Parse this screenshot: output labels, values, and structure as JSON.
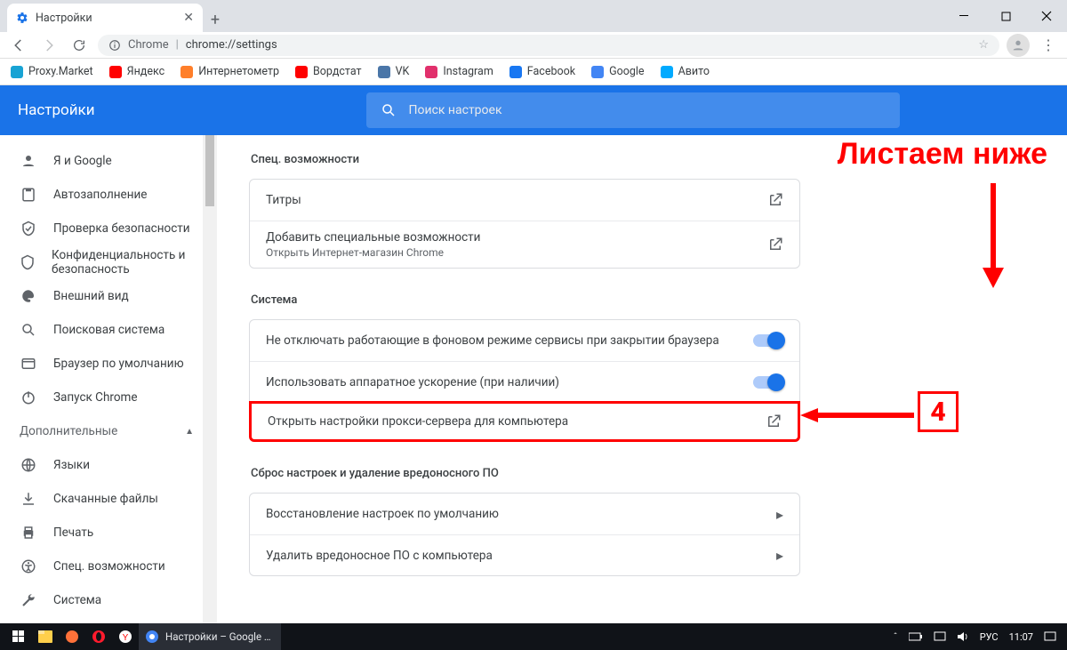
{
  "window": {
    "tab_title": "Настройки",
    "url_prefix": "Chrome",
    "url_rest": "chrome://settings"
  },
  "bookmarks": [
    {
      "label": "Proxy.Market",
      "color": "#18a3d4"
    },
    {
      "label": "Яндекс",
      "color": "#ff0000"
    },
    {
      "label": "Интернетометр",
      "color": "#ff7f2a"
    },
    {
      "label": "Вордстат",
      "color": "#ff0000"
    },
    {
      "label": "VK",
      "color": "#4a76a8"
    },
    {
      "label": "Instagram",
      "color": "#e1306c"
    },
    {
      "label": "Facebook",
      "color": "#1877f2"
    },
    {
      "label": "Google",
      "color": "#4285f4"
    },
    {
      "label": "Авито",
      "color": "#00aaff"
    }
  ],
  "header": {
    "title": "Настройки",
    "search_placeholder": "Поиск настроек"
  },
  "sidebar": {
    "items": [
      {
        "label": "Я и Google",
        "icon": "person"
      },
      {
        "label": "Автозаполнение",
        "icon": "autofill"
      },
      {
        "label": "Проверка безопасности",
        "icon": "safety"
      },
      {
        "label": "Конфиденциальность и безопасность",
        "icon": "shield"
      },
      {
        "label": "Внешний вид",
        "icon": "palette"
      },
      {
        "label": "Поисковая система",
        "icon": "search"
      },
      {
        "label": "Браузер по умолчанию",
        "icon": "browser"
      },
      {
        "label": "Запуск Chrome",
        "icon": "power"
      }
    ],
    "group_label": "Дополнительные",
    "extra": [
      {
        "label": "Языки",
        "icon": "globe"
      },
      {
        "label": "Скачанные файлы",
        "icon": "download"
      },
      {
        "label": "Печать",
        "icon": "print"
      },
      {
        "label": "Спец. возможности",
        "icon": "a11y"
      },
      {
        "label": "Система",
        "icon": "wrench"
      }
    ]
  },
  "sections": {
    "a11y": {
      "title": "Спец. возможности",
      "rows": [
        {
          "title": "Титры",
          "action": "launch"
        },
        {
          "title": "Добавить специальные возможности",
          "sub": "Открыть Интернет-магазин Chrome",
          "action": "launch"
        }
      ]
    },
    "system": {
      "title": "Система",
      "rows": [
        {
          "title": "Не отключать работающие в фоновом режиме сервисы при закрытии браузера",
          "action": "toggle"
        },
        {
          "title": "Использовать аппаратное ускорение (при наличии)",
          "action": "toggle"
        },
        {
          "title": "Открыть настройки прокси-сервера для компьютера",
          "action": "launch",
          "highlight": true
        }
      ]
    },
    "reset": {
      "title": "Сброс настроек и удаление вредоносного ПО",
      "rows": [
        {
          "title": "Восстановление настроек по умолчанию",
          "action": "chev"
        },
        {
          "title": "Удалить вредоносное ПО с компьютера",
          "action": "chev"
        }
      ]
    }
  },
  "annotations": {
    "scroll_hint": "Листаем ниже",
    "step_number": "4"
  },
  "taskbar": {
    "app_label": "Настройки – Google …",
    "lang": "РУС",
    "clock": "11:07"
  }
}
